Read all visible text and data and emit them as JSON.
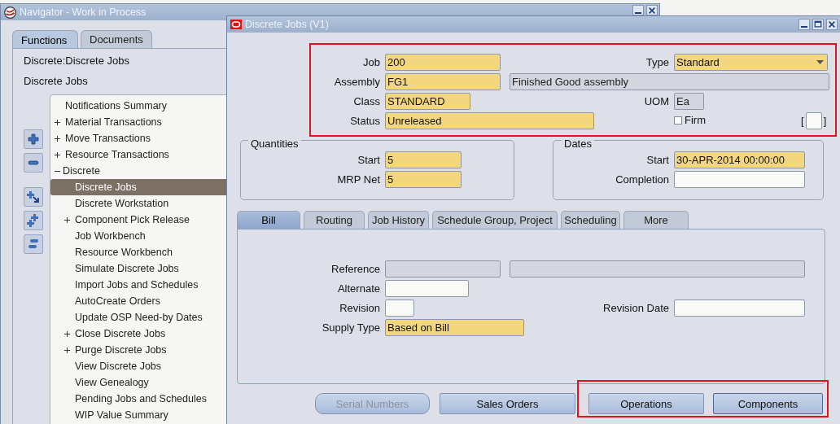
{
  "navigator": {
    "title": "Navigator - Work in Process",
    "tabs": [
      {
        "label": "Functions",
        "selected": true
      },
      {
        "label": "Documents",
        "selected": false
      }
    ],
    "context": "Discrete:Discrete Jobs",
    "current": "Discrete Jobs",
    "tree": [
      {
        "label": "Notifications Summary",
        "selected": false
      },
      {
        "label": "Material Transactions",
        "selected": false,
        "expanded": false
      },
      {
        "label": "Move Transactions",
        "selected": false,
        "expanded": false
      },
      {
        "label": "Resource Transactions",
        "selected": false,
        "expanded": false
      },
      {
        "label": "Discrete",
        "selected": false,
        "expanded": true,
        "children": [
          {
            "label": "Discrete Jobs",
            "selected": true
          },
          {
            "label": "Discrete Workstation",
            "selected": false
          },
          {
            "label": "Component Pick Release",
            "selected": false,
            "expanded": false
          },
          {
            "label": "Job Workbench",
            "selected": false
          },
          {
            "label": "Resource Workbench",
            "selected": false
          },
          {
            "label": "Simulate Discrete Jobs",
            "selected": false
          },
          {
            "label": "Import Jobs and Schedules",
            "selected": false
          },
          {
            "label": "AutoCreate Orders",
            "selected": false
          },
          {
            "label": "Update OSP Need-by Dates",
            "selected": false
          },
          {
            "label": "Close Discrete Jobs",
            "selected": false,
            "expanded": false
          },
          {
            "label": "Purge Discrete Jobs",
            "selected": false,
            "expanded": false
          },
          {
            "label": "View Discrete Jobs",
            "selected": false
          },
          {
            "label": "View Genealogy",
            "selected": false
          },
          {
            "label": "Pending Jobs and Schedules",
            "selected": false
          },
          {
            "label": "WIP Value Summary",
            "selected": false
          }
        ]
      }
    ]
  },
  "form": {
    "title": "Discrete Jobs (V1)",
    "header": {
      "job": {
        "label": "Job",
        "value": "200",
        "kind": "required"
      },
      "type": {
        "label": "Type",
        "value": "Standard",
        "kind": "required",
        "dropdown": true
      },
      "assembly": {
        "label": "Assembly",
        "value": "FG1",
        "kind": "required"
      },
      "assembly_description": {
        "value": "Finished Good assembly",
        "kind": "readonly"
      },
      "class": {
        "label": "Class",
        "value": "STANDARD",
        "kind": "required"
      },
      "uom": {
        "label": "UOM",
        "value": "Ea",
        "kind": "readonly"
      },
      "status": {
        "label": "Status",
        "value": "Unreleased",
        "kind": "required"
      },
      "firm": {
        "label": "Firm",
        "checked": false
      },
      "flex_field": {
        "open": "[",
        "close": "]",
        "kind": "optional"
      }
    },
    "quantities": {
      "title": "Quantities",
      "start": {
        "label": "Start",
        "value": "5",
        "kind": "required"
      },
      "mrp_net": {
        "label": "MRP Net",
        "value": "5",
        "kind": "required"
      }
    },
    "dates": {
      "title": "Dates",
      "start": {
        "label": "Start",
        "value": "30-APR-2014 00:00:00",
        "kind": "required"
      },
      "completion": {
        "label": "Completion",
        "kind": "optional"
      }
    },
    "tabs": [
      {
        "label": "Bill",
        "selected": true
      },
      {
        "label": "Routing",
        "selected": false
      },
      {
        "label": "Job History",
        "selected": false
      },
      {
        "label": "Schedule Group, Project",
        "selected": false
      },
      {
        "label": "Scheduling",
        "selected": false
      },
      {
        "label": "More",
        "selected": false
      }
    ],
    "bill": {
      "reference": {
        "label": "Reference",
        "kind": "readonly"
      },
      "reference_description": {
        "kind": "readonly"
      },
      "alternate": {
        "label": "Alternate",
        "kind": "optional"
      },
      "revision": {
        "label": "Revision",
        "kind": "optional"
      },
      "revision_date": {
        "label": "Revision Date",
        "kind": "optional"
      },
      "supply_type": {
        "label": "Supply Type",
        "value": "Based on Bill",
        "kind": "required"
      }
    },
    "buttons": [
      {
        "label": "Serial Numbers",
        "disabled": true
      },
      {
        "label": "Sales Orders",
        "disabled": false
      },
      {
        "label": "Operations",
        "disabled": false
      },
      {
        "label": "Components",
        "disabled": false
      }
    ]
  }
}
